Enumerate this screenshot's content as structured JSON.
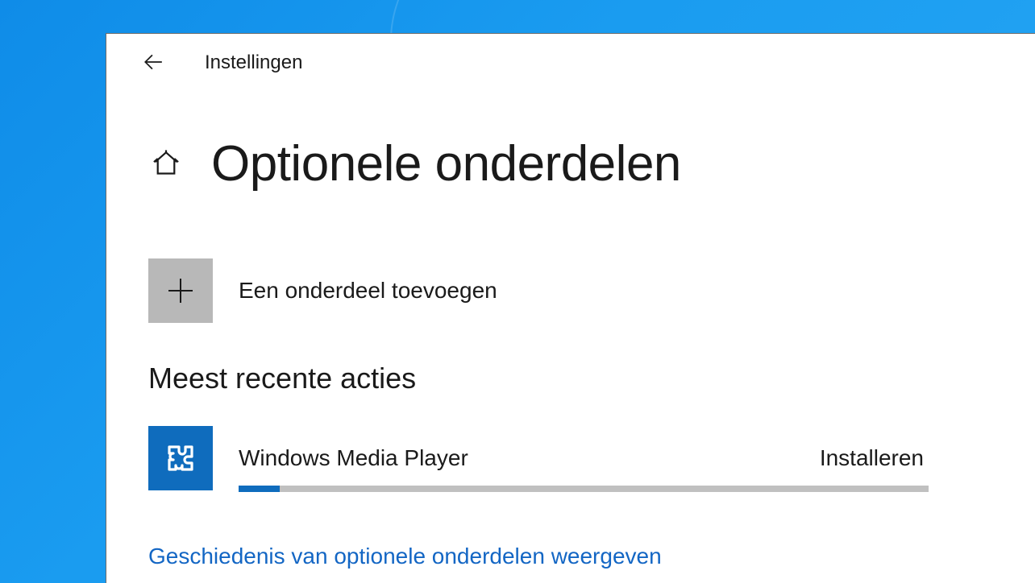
{
  "titlebar": {
    "app_title": "Instellingen"
  },
  "page": {
    "title": "Optionele onderdelen"
  },
  "add_feature": {
    "label": "Een onderdeel toevoegen"
  },
  "recent_actions": {
    "heading": "Meest recente acties",
    "item": {
      "name": "Windows Media Player",
      "status": "Installeren",
      "progress_percent": 6
    }
  },
  "history_link": {
    "label": "Geschiedenis van optionele onderdelen weergeven"
  },
  "colors": {
    "accent": "#0f6cbd",
    "link": "#1366c4",
    "grey_box": "#b8b8b8",
    "progress_track": "#c0c0c0"
  }
}
